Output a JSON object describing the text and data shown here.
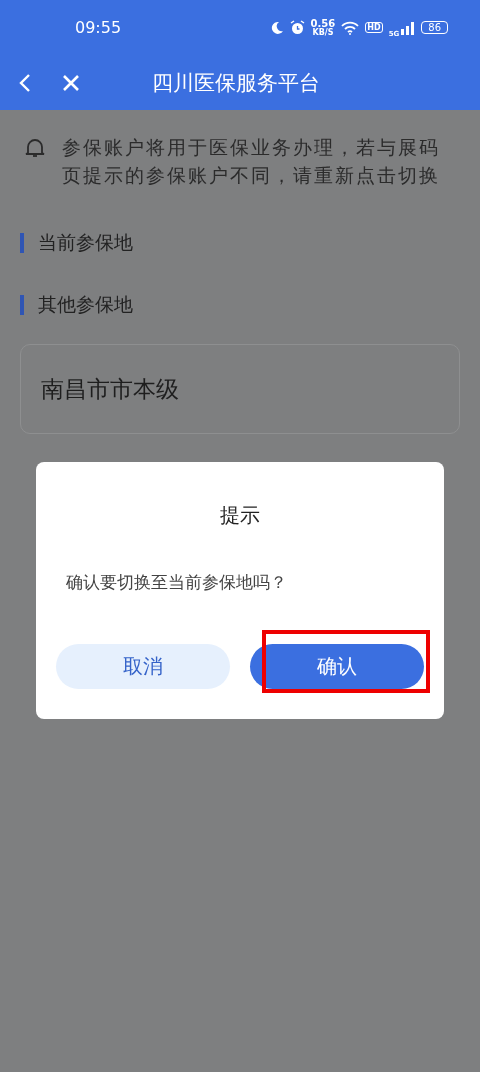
{
  "status_bar": {
    "time": "09:55",
    "net_speed": "0.56",
    "net_unit": "KB/S",
    "hd": "HD",
    "network": "5G",
    "battery": "86"
  },
  "header": {
    "title": "四川医保服务平台"
  },
  "notice": {
    "text": "参保账户将用于医保业务办理，若与展码页提示的参保账户不同，请重新点击切换"
  },
  "sections": [
    {
      "title": "当前参保地"
    },
    {
      "title": "其他参保地",
      "items": [
        "南昌市市本级"
      ]
    }
  ],
  "dialog": {
    "title": "提示",
    "message": "确认要切换至当前参保地吗？",
    "buttons": [
      {
        "label": "取消",
        "kind": "secondary",
        "highlighted": false
      },
      {
        "label": "确认",
        "kind": "primary",
        "highlighted": true
      }
    ]
  }
}
